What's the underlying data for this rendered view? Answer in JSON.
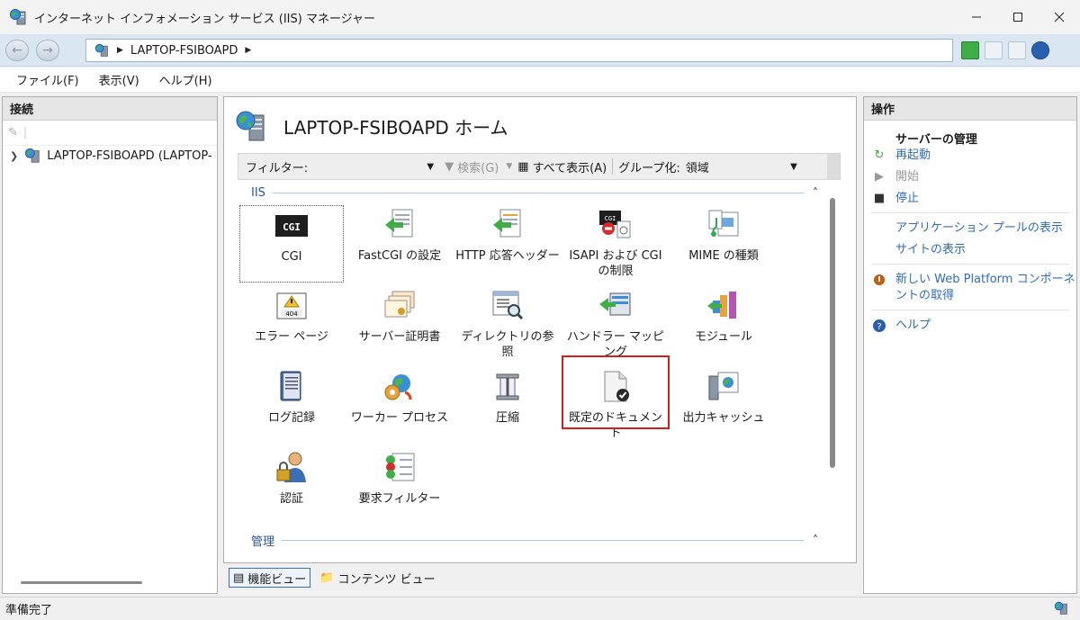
{
  "window": {
    "title": "インターネット インフォメーション サービス (IIS) マネージャー"
  },
  "address": {
    "crumb": "LAPTOP-FSIBOAPD"
  },
  "menu": [
    "ファイル(F)",
    "表示(V)",
    "ヘルプ(H)"
  ],
  "connections": {
    "header": "接続",
    "tree_item": "LAPTOP-FSIBOAPD (LAPTOP-"
  },
  "center": {
    "title": "LAPTOP-FSIBOAPD ホーム",
    "filter": {
      "label": "フィルター:",
      "search": "検索(G)",
      "show_all": "すべて表示(A)",
      "group_label": "グループ化:",
      "group_value": "領域"
    },
    "sections": {
      "iis": "IIS",
      "manage": "管理"
    },
    "features": [
      {
        "label": "CGI",
        "icon": "cgi-icon"
      },
      {
        "label": "FastCGI の設定",
        "icon": "fastcgi-icon"
      },
      {
        "label": "HTTP 応答ヘッダー",
        "icon": "http-headers-icon"
      },
      {
        "label": "ISAPI および CGI の制限",
        "icon": "isapi-icon"
      },
      {
        "label": "MIME の種類",
        "icon": "mime-icon"
      },
      {
        "label": "エラー ページ",
        "icon": "error-page-icon"
      },
      {
        "label": "サーバー証明書",
        "icon": "certificate-icon"
      },
      {
        "label": "ディレクトリの参照",
        "icon": "directory-browse-icon"
      },
      {
        "label": "ハンドラー マッピング",
        "icon": "handler-mapping-icon"
      },
      {
        "label": "モジュール",
        "icon": "modules-icon"
      },
      {
        "label": "ログ記録",
        "icon": "logging-icon"
      },
      {
        "label": "ワーカー プロセス",
        "icon": "worker-process-icon"
      },
      {
        "label": "圧縮",
        "icon": "compression-icon"
      },
      {
        "label": "既定のドキュメント",
        "icon": "default-document-icon"
      },
      {
        "label": "出力キャッシュ",
        "icon": "output-cache-icon"
      },
      {
        "label": "認証",
        "icon": "authentication-icon"
      },
      {
        "label": "要求フィルター",
        "icon": "request-filter-icon"
      }
    ],
    "view_tabs": {
      "features": "機能ビュー",
      "content": "コンテンツ ビュー"
    }
  },
  "actions": {
    "header": "操作",
    "group_title": "サーバーの管理",
    "restart": "再起動",
    "start": "開始",
    "stop": "停止",
    "app_pools": "アプリケーション プールの表示",
    "sites": "サイトの表示",
    "web_platform": "新しい Web Platform コンポーネントの取得",
    "help": "ヘルプ"
  },
  "status": {
    "text": "準備完了"
  },
  "colors": {
    "highlight": "#d51d1d",
    "link": "#2f6bc0"
  }
}
